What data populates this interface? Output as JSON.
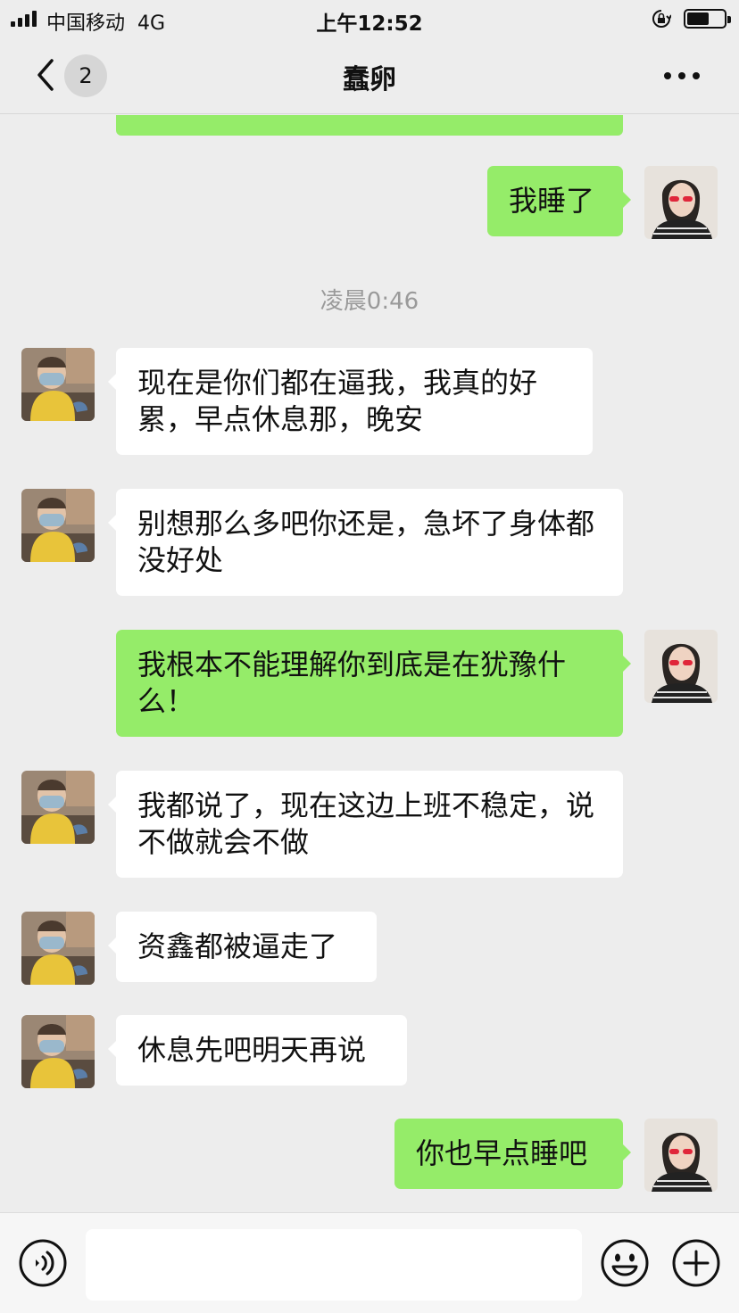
{
  "status_bar": {
    "carrier": "中国移动",
    "network": "4G",
    "time": "上午12:52"
  },
  "nav": {
    "title": "蠢卵",
    "unread_count": "2"
  },
  "timestamp": "凌晨0:46",
  "messages": [
    {
      "side": "out",
      "text": "我睡了"
    },
    {
      "side": "in",
      "text": "现在是你们都在逼我，我真的好累，早点休息那，晚安"
    },
    {
      "side": "in",
      "text": "别想那么多吧你还是，急坏了身体都没好处"
    },
    {
      "side": "out",
      "text": "我根本不能理解你到底是在犹豫什么！"
    },
    {
      "side": "in",
      "text": "我都说了，现在这边上班不稳定，说不做就会不做"
    },
    {
      "side": "in",
      "text": "资鑫都被逼走了"
    },
    {
      "side": "in",
      "text": "休息先吧明天再说"
    },
    {
      "side": "out",
      "text": "你也早点睡吧"
    }
  ],
  "input": {
    "value": "",
    "placeholder": ""
  },
  "icons": {
    "back": "chevron-left-icon",
    "more": "more-dots-icon",
    "voice": "voice-icon",
    "emoji": "emoji-icon",
    "plus": "plus-icon"
  },
  "colors": {
    "outgoing_bubble": "#95ec69",
    "incoming_bubble": "#ffffff",
    "background": "#ededed"
  }
}
